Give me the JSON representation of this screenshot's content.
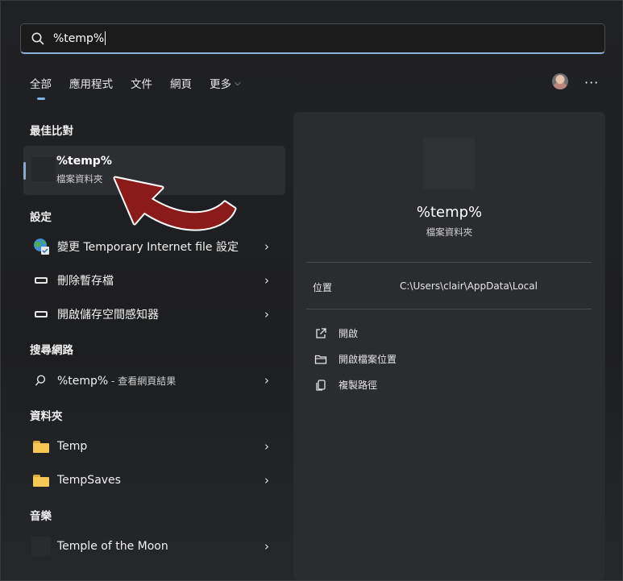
{
  "search": {
    "query": "%temp%"
  },
  "tabs": [
    {
      "label": "全部",
      "active": true
    },
    {
      "label": "應用程式"
    },
    {
      "label": "文件"
    },
    {
      "label": "網頁"
    },
    {
      "label": "更多"
    }
  ],
  "header": {
    "more_menu": "···"
  },
  "best_match": {
    "section": "最佳比對",
    "title": "%temp%",
    "subtitle": "檔案資料夾"
  },
  "settings": {
    "section": "設定",
    "items": [
      {
        "label": "變更 Temporary Internet file 設定",
        "icon": "internet-options-icon"
      },
      {
        "label": "刪除暫存檔",
        "icon": "storage-icon"
      },
      {
        "label": "開啟儲存空間感知器",
        "icon": "storage-icon"
      }
    ]
  },
  "web": {
    "section": "搜尋網路",
    "query": "%temp%",
    "note": " - 查看網頁結果"
  },
  "folders": {
    "section": "資料夾",
    "items": [
      {
        "label": "Temp"
      },
      {
        "label": "TempSaves"
      }
    ]
  },
  "music": {
    "section": "音樂",
    "items": [
      {
        "label": "Temple of the Moon"
      }
    ]
  },
  "panel": {
    "title": "%temp%",
    "subtitle": "檔案資料夾",
    "location_label": "位置",
    "location_value": "C:\\Users\\clair\\AppData\\Local",
    "actions": [
      {
        "label": "開啟",
        "icon": "open-external-icon"
      },
      {
        "label": "開啟檔案位置",
        "icon": "folder-open-icon"
      },
      {
        "label": "複製路徑",
        "icon": "copy-icon"
      }
    ]
  },
  "colors": {
    "accent": "#7fb2e5",
    "annotation_arrow": "#8b1a1a",
    "folder": "#f6c753"
  }
}
